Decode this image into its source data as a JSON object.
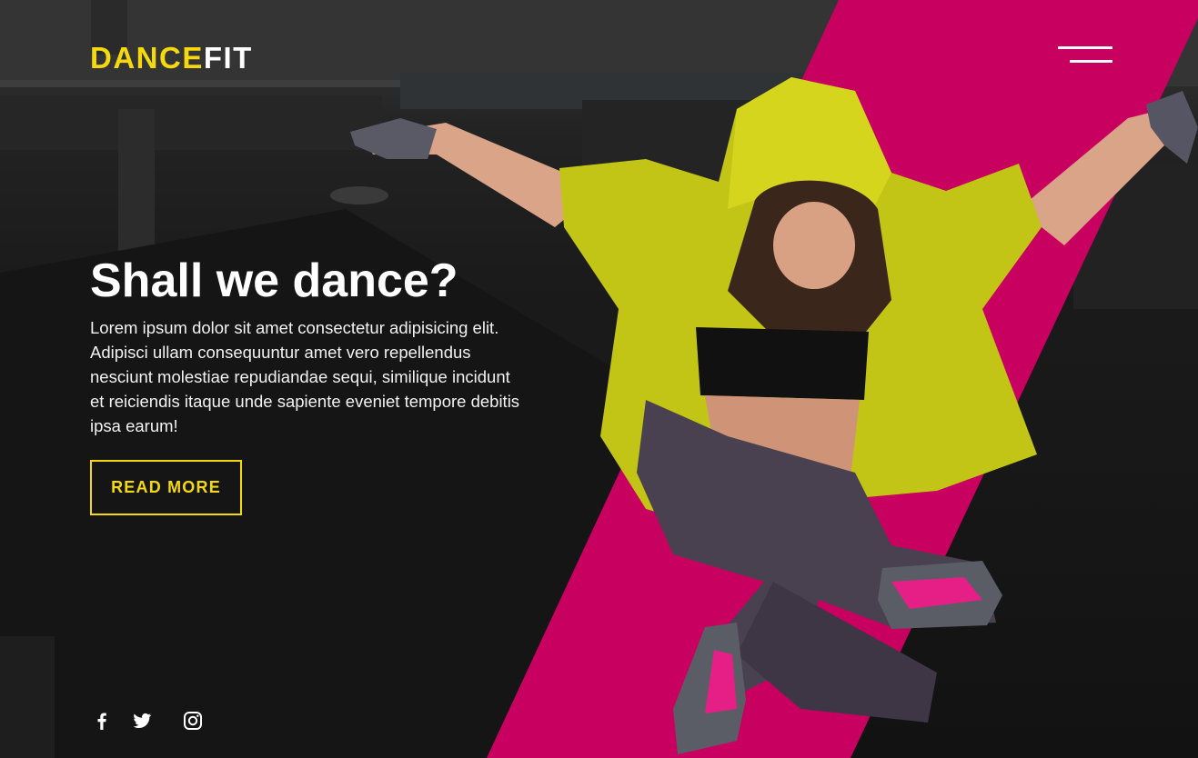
{
  "brand": {
    "part1": "DANCE",
    "part2": "FIT"
  },
  "colors": {
    "accent_yellow": "#f5d90f",
    "stripe_magenta": "#c8005f",
    "background": "#141414"
  },
  "nav": {
    "menu_icon": "hamburger-menu-icon"
  },
  "hero": {
    "title": "Shall we dance?",
    "body": "Lorem ipsum dolor sit amet consectetur adipisicing elit. Adipisci ullam consequuntur amet vero repellendus nesciunt molestiae repudiandae sequi, similique incidunt et reiciendis itaque unde sapiente eveniet tempore debitis ipsa earum!",
    "cta_label": "READ MORE"
  },
  "social": {
    "icons": [
      "facebook-icon",
      "twitter-icon",
      "instagram-icon"
    ]
  }
}
